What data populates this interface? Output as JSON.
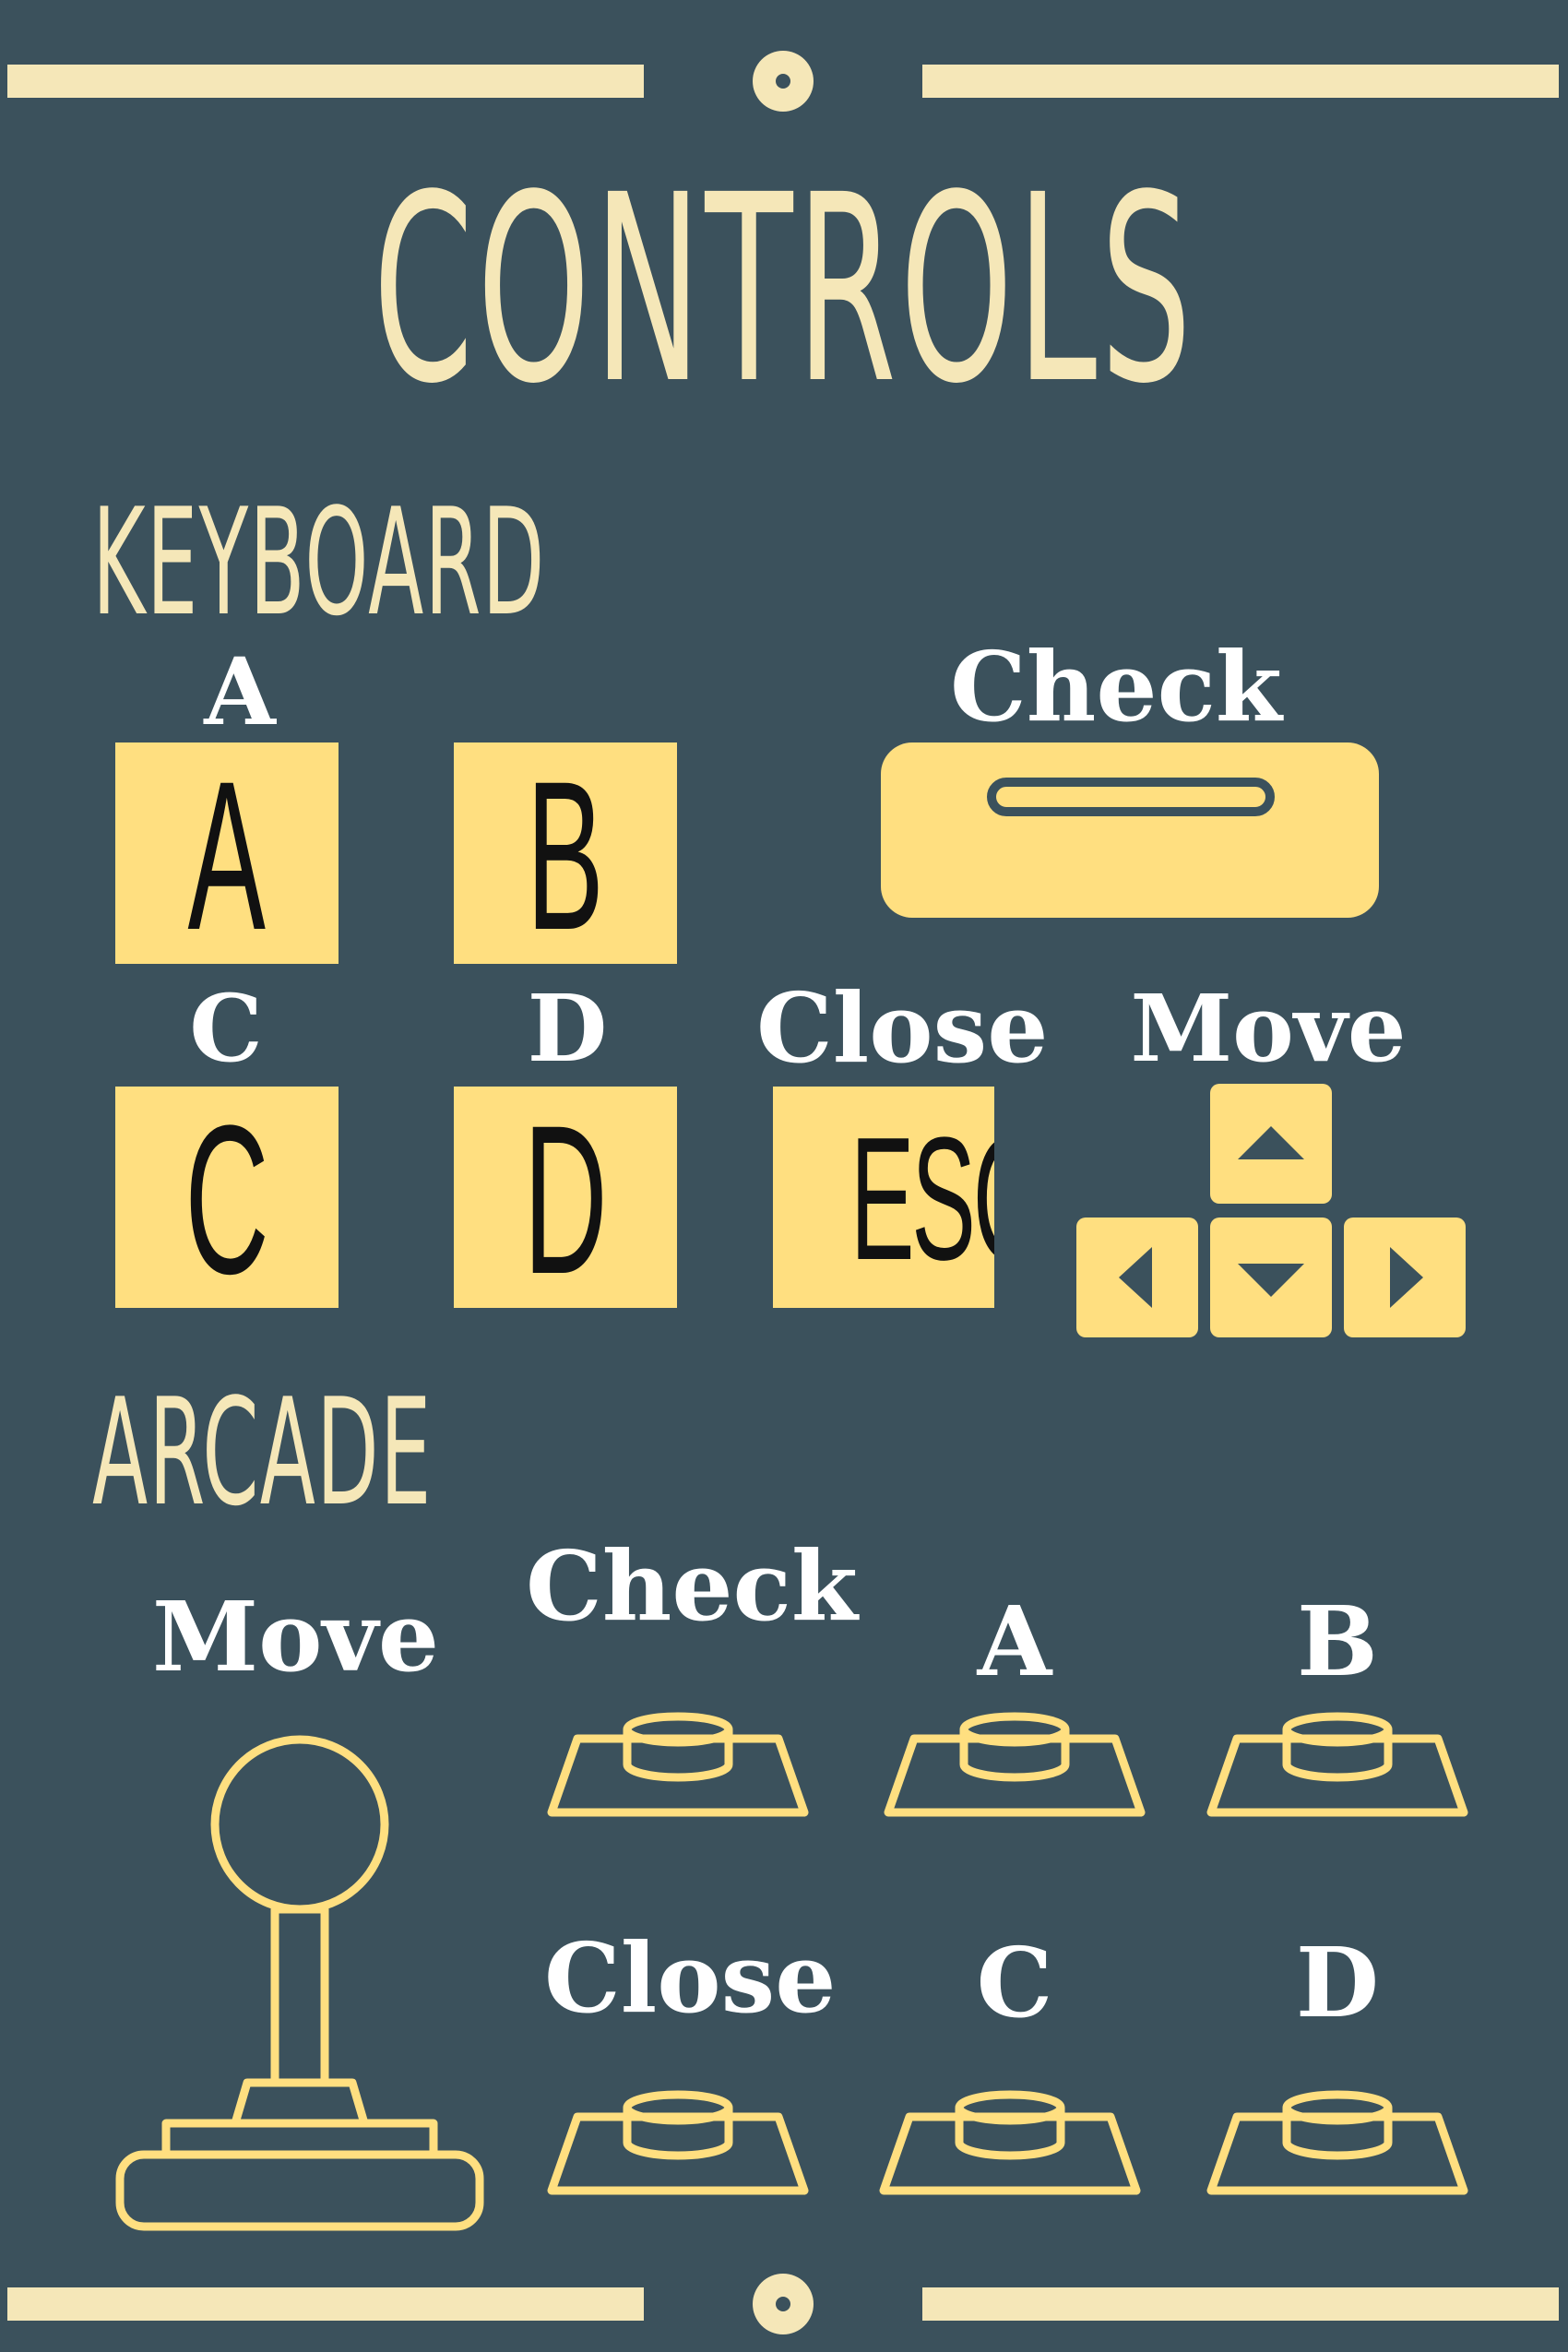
{
  "title": "CONTROLS",
  "sections": {
    "keyboard": "KEYBOARD",
    "arcade": "ARCADE"
  },
  "keyboard": {
    "a_label": "A",
    "a_key": "A",
    "b_key": "B",
    "c_label": "C",
    "c_key": "C",
    "d_label": "D",
    "d_key": "D",
    "check_label": "Check",
    "close_label": "Close",
    "close_key": "ESC",
    "move_label": "Move"
  },
  "arcade": {
    "move_label": "Move",
    "check_label": "Check",
    "a_label": "A",
    "b_label": "B",
    "close_label": "Close",
    "c_label": "C",
    "d_label": "D"
  },
  "colors": {
    "background": "#3b515c",
    "cream": "#f5e7b8",
    "key_yellow": "#ffdf80",
    "label_white": "#ffffff"
  },
  "icons": [
    "spacebar-icon",
    "arrow-keys-icon",
    "joystick-icon",
    "arcade-button-icon"
  ]
}
